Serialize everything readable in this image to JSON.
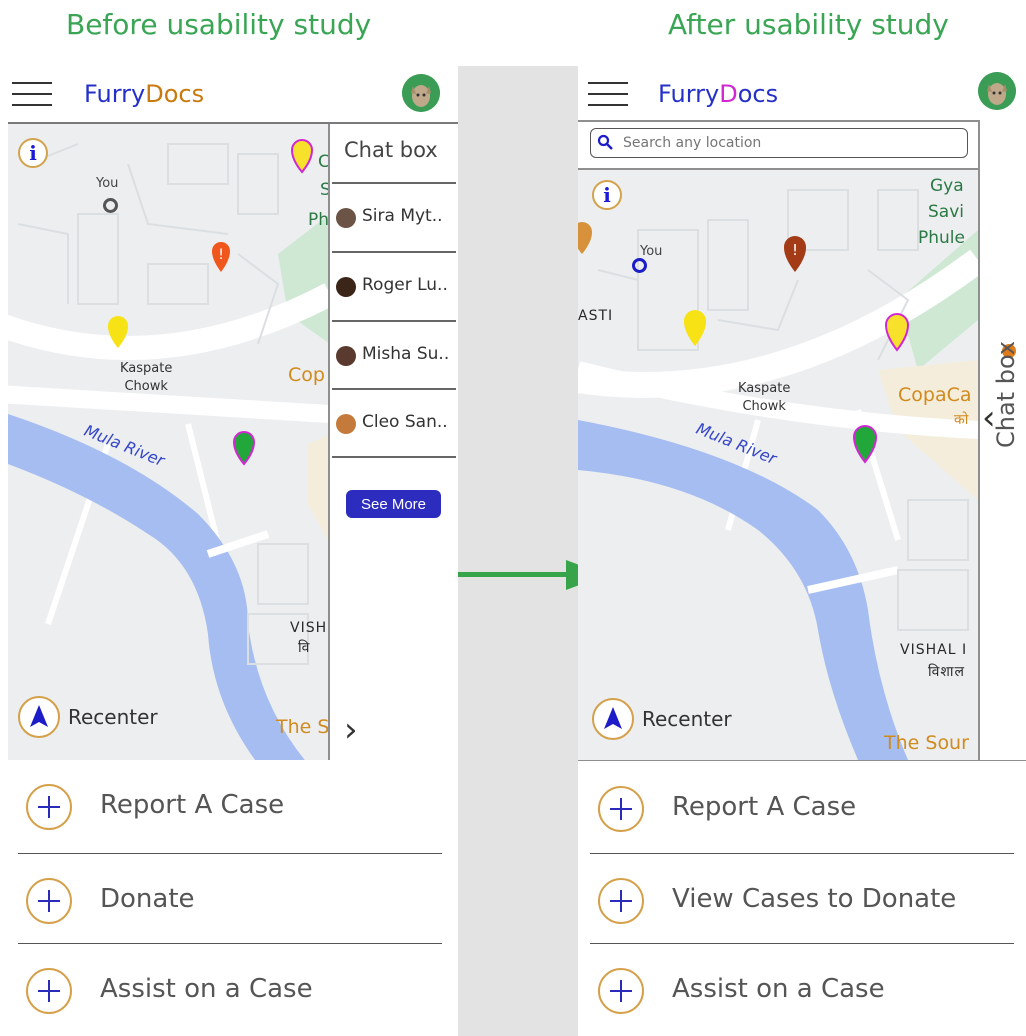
{
  "headings": {
    "before": "Before usability study",
    "after": "After usability study"
  },
  "colors": {
    "heading": "#3aa655",
    "arrow": "#37a34a",
    "brand_blue": "#2530c8",
    "brand_orange": "#c9790d",
    "brand_magenta": "#d326d3",
    "accent": "#d5a04a",
    "plus": "#2b2bbb",
    "see_more_bg": "#2c2dbf"
  },
  "before": {
    "brand": {
      "part1": "Furry",
      "part2": "Docs"
    },
    "map": {
      "you_label": "You",
      "kaspate": "Kaspate\nChowk",
      "river": "Mula River",
      "copa": "Cop",
      "vishal": "VISH",
      "vishal_hindi": "वि",
      "the_s": "The S",
      "green_letter": "C",
      "ph": "Ph",
      "s_letter": "S",
      "recenter": "Recenter"
    },
    "chat": {
      "title": "Chat box",
      "items": [
        {
          "name": "Sira Myt.."
        },
        {
          "name": "Roger Lu.."
        },
        {
          "name": "Misha Su.."
        },
        {
          "name": "Cleo San.."
        }
      ],
      "see_more": "See More",
      "expand_icon": "chevron-right-icon"
    },
    "actions": [
      {
        "label": "Report A Case"
      },
      {
        "label": "Donate"
      },
      {
        "label": "Assist on a Case"
      }
    ]
  },
  "after": {
    "brand": {
      "part1": "Furry",
      "part2": "D",
      "part3": "ocs"
    },
    "search": {
      "placeholder": "Search any location",
      "icon": "search-icon"
    },
    "map": {
      "you_label": "You",
      "kaspate": "Kaspate\nChowk",
      "river": "Mula River",
      "copa": "CopaCa",
      "copa_hindi": "को",
      "vishal": "VISHAL I",
      "vishal_hindi": "विशाल",
      "the_sour": "The Sour",
      "gya": "Gya",
      "savi": "Savi",
      "phule": "Phule",
      "asti": "ASTI",
      "recenter": "Recenter"
    },
    "chat_tab": {
      "label": "Chat box",
      "collapse_icon": "chevron-left-icon"
    },
    "actions": [
      {
        "label": "Report A Case"
      },
      {
        "label": "View Cases to Donate"
      },
      {
        "label": "Assist on a Case"
      }
    ]
  }
}
